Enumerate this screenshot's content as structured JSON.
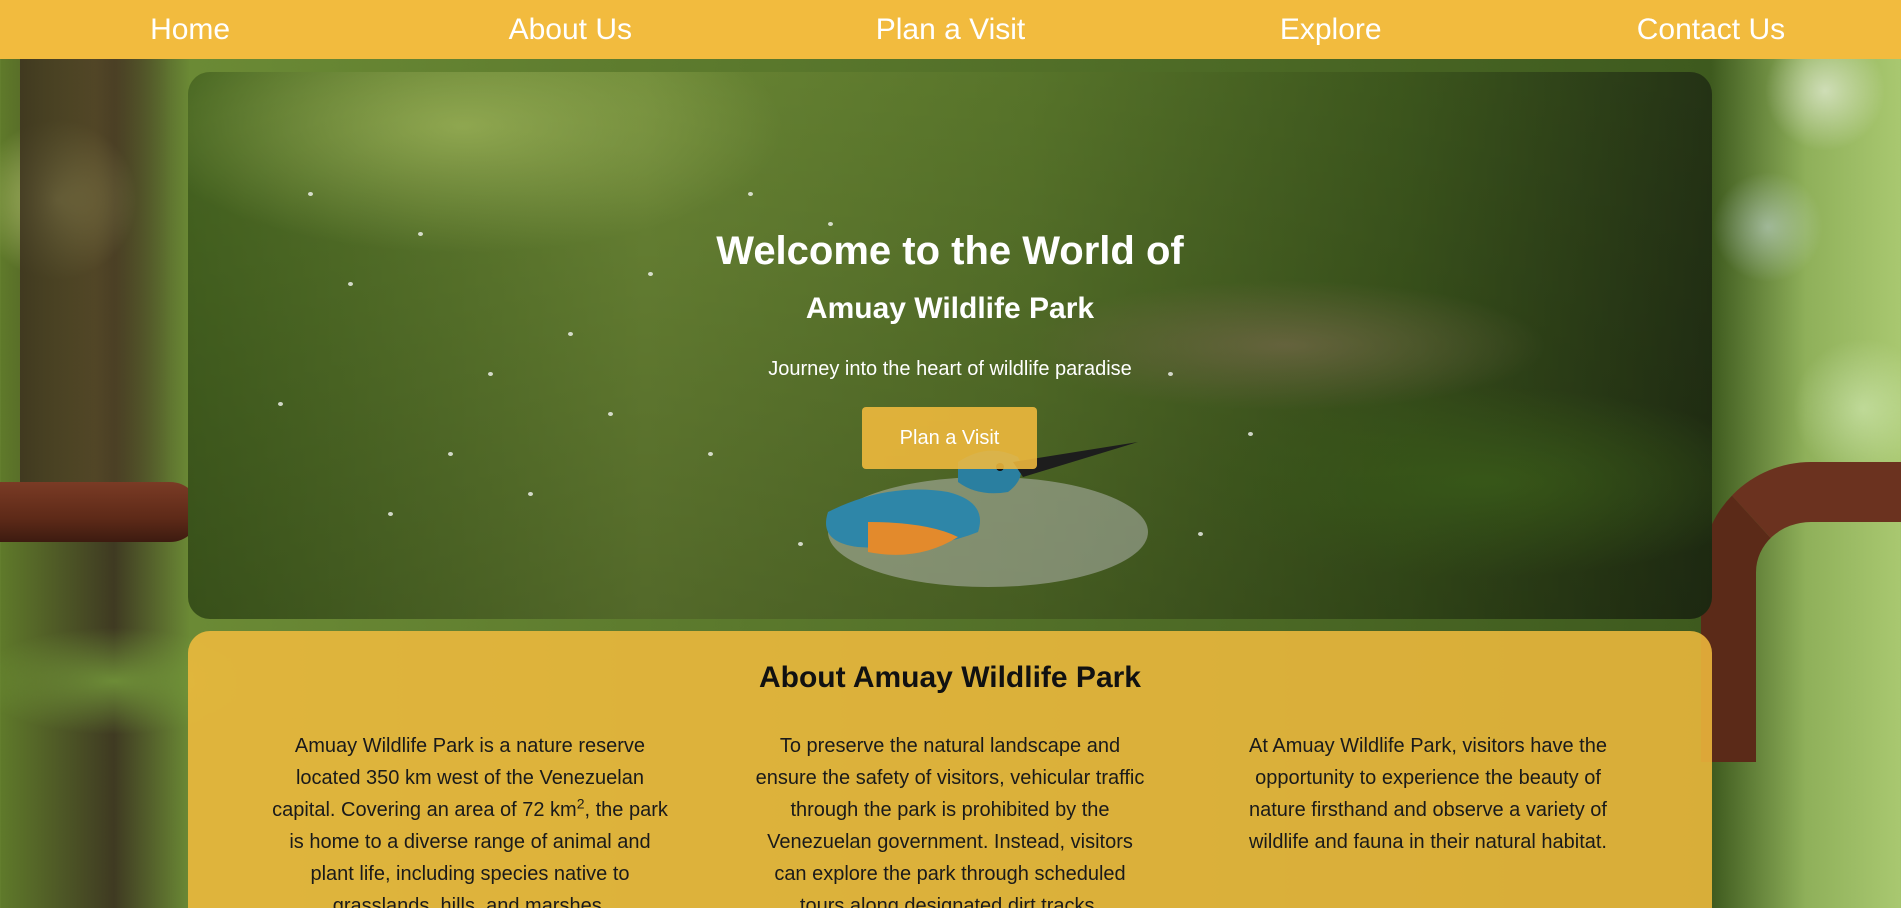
{
  "nav": {
    "items": [
      "Home",
      "About Us",
      "Plan a Visit",
      "Explore",
      "Contact Us"
    ]
  },
  "hero": {
    "title": "Welcome to the World of",
    "subtitle": "Amuay Wildlife Park",
    "tagline": "Journey into the heart of wildlife paradise",
    "button_label": "Plan a Visit"
  },
  "about": {
    "title": "About Amuay Wildlife Park",
    "col1_part1": "Amuay Wildlife Park is a nature reserve located 350 km west of the Venezuelan capital. Covering an area of 72 km",
    "col1_sup": "2",
    "col1_part2": ", the park is home to a diverse range of animal and plant life, including species native to grasslands, hills, and marshes.",
    "col2": "To preserve the natural landscape and ensure the safety of visitors, vehicular traffic through the park is prohibited by the Venezuelan government. Instead, visitors can explore the park through scheduled tours along designated dirt tracks.",
    "col3": "At Amuay Wildlife Park, visitors have the opportunity to experience the beauty of nature firsthand and observe a variety of wildlife and fauna in their natural habitat."
  },
  "colors": {
    "accent": "#f2bb3e",
    "text_light": "#ffffff",
    "text_dark": "#111111"
  }
}
